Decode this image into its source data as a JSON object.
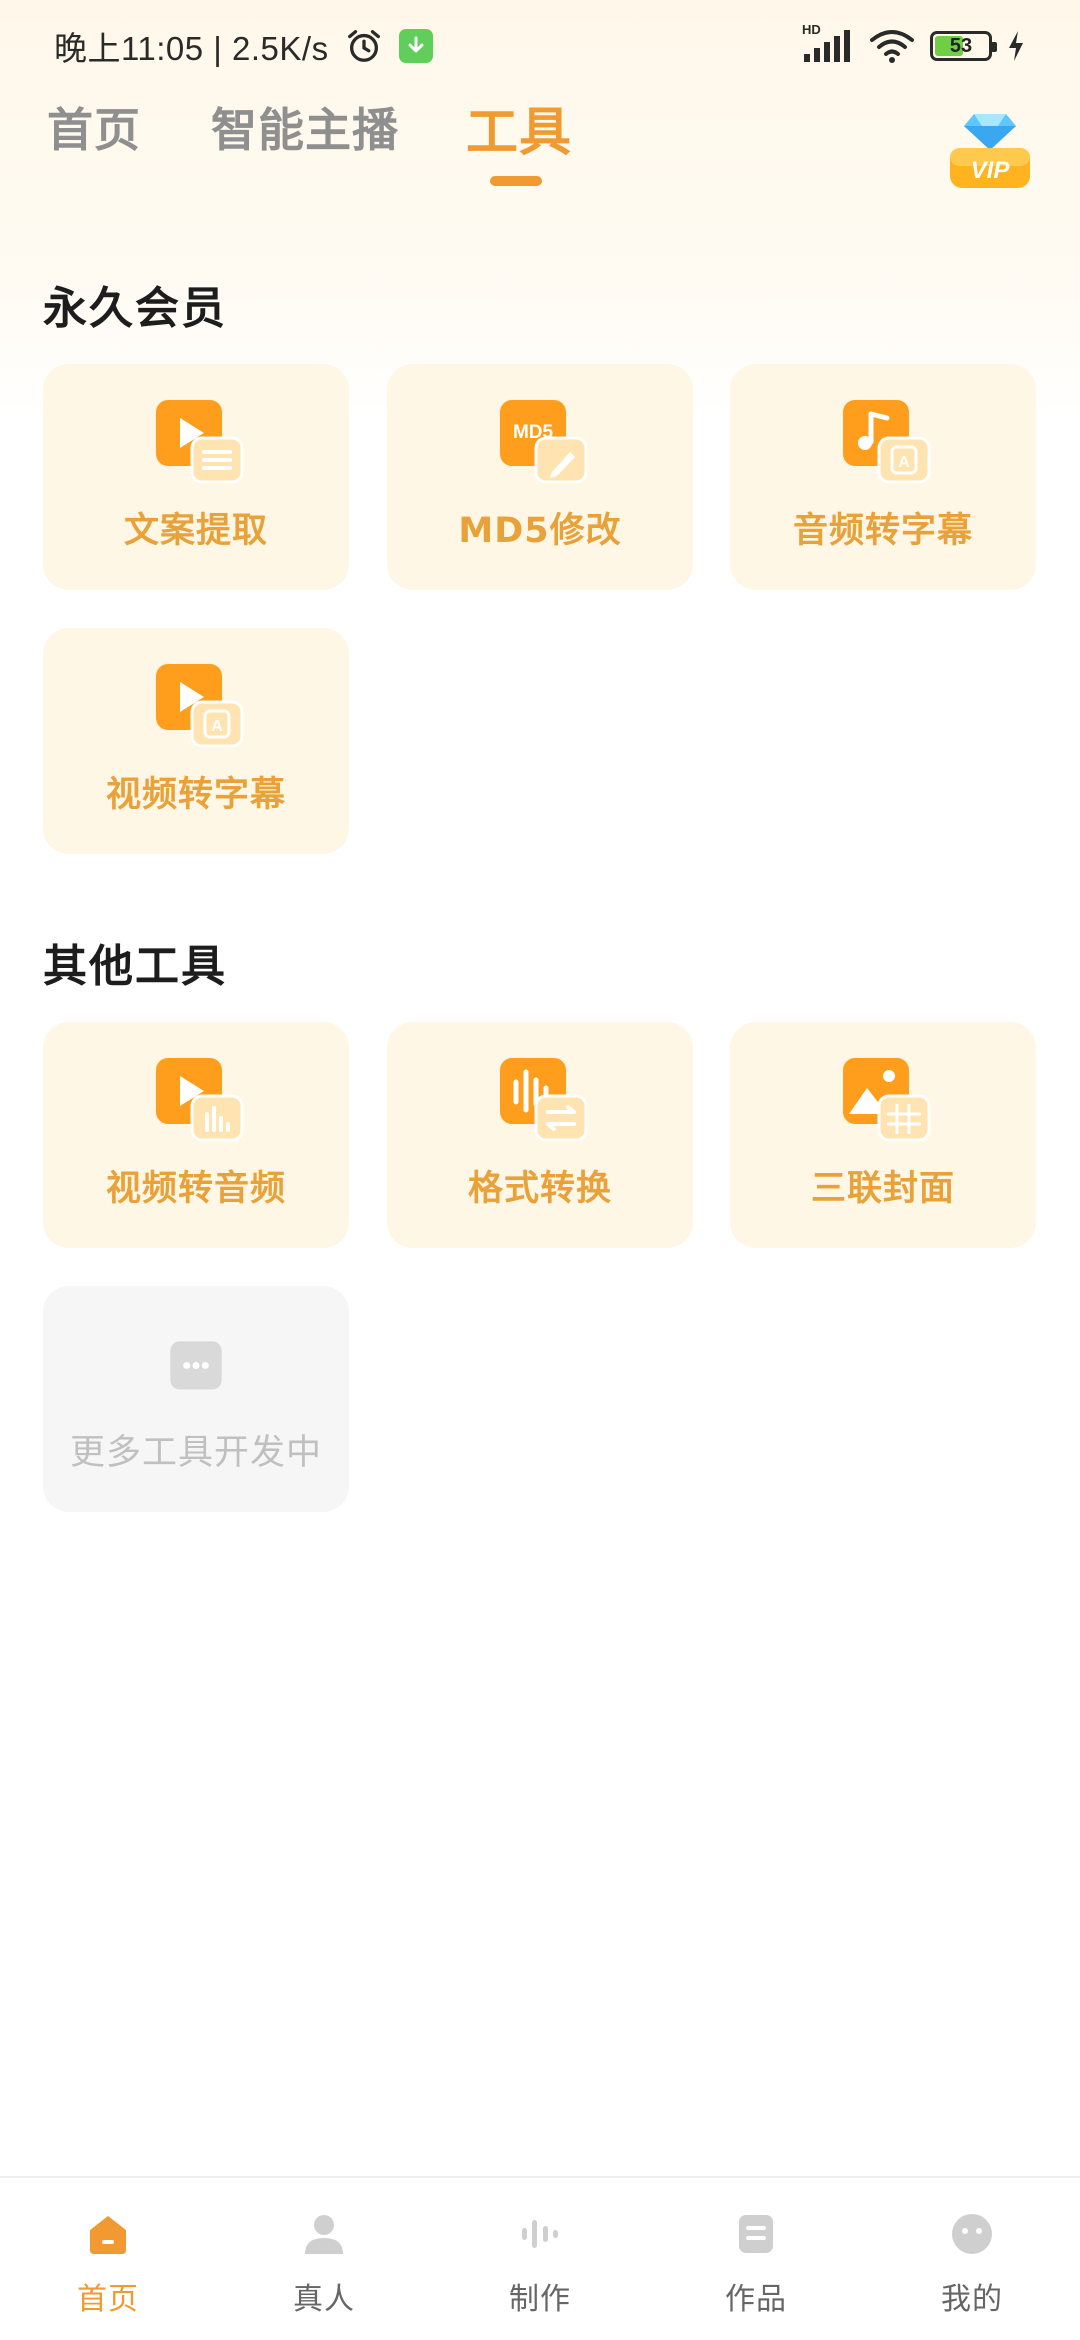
{
  "status_bar": {
    "time": "晚上11:05 | 2.5K/s",
    "network_badge": "HD",
    "battery_level": "53",
    "icons": [
      "alarm-icon",
      "download-icon",
      "signal-icon",
      "wifi-icon",
      "battery-icon",
      "charging-icon"
    ]
  },
  "header": {
    "tabs": [
      {
        "label": "首页",
        "active": false
      },
      {
        "label": "智能主播",
        "active": false
      },
      {
        "label": "工具",
        "active": true
      }
    ],
    "vip_label": "VIP"
  },
  "sections": [
    {
      "title": "永久会员",
      "items": [
        {
          "label": "文案提取",
          "icon": "play-text-icon",
          "badge": ""
        },
        {
          "label": "MD5修改",
          "icon": "md5-edit-icon",
          "badge": "MD5"
        },
        {
          "label": "音频转字幕",
          "icon": "music-subtitle-icon",
          "badge": "A"
        },
        {
          "label": "视频转字幕",
          "icon": "video-subtitle-icon",
          "badge": "A"
        }
      ]
    },
    {
      "title": "其他工具",
      "items": [
        {
          "label": "视频转音频",
          "icon": "video-audio-icon",
          "badge": ""
        },
        {
          "label": "格式转换",
          "icon": "format-convert-icon",
          "badge": ""
        },
        {
          "label": "三联封面",
          "icon": "triple-cover-icon",
          "badge": ""
        },
        {
          "label": "更多工具开发中",
          "icon": "more-icon",
          "badge": "",
          "disabled": true
        }
      ]
    }
  ],
  "bottom_nav": [
    {
      "label": "首页",
      "icon": "home-icon",
      "active": true
    },
    {
      "label": "真人",
      "icon": "person-icon",
      "active": false
    },
    {
      "label": "制作",
      "icon": "waveform-icon",
      "active": false
    },
    {
      "label": "作品",
      "icon": "works-icon",
      "active": false
    },
    {
      "label": "我的",
      "icon": "profile-face-icon",
      "active": false
    }
  ],
  "colors": {
    "accent": "#f19a32",
    "card_bg": "#fff7e5",
    "card_label": "#e9a13a",
    "icon_orange": "#ff9d1c",
    "icon_badge": "#ffe3b0",
    "disabled_bg": "#f6f6f6",
    "disabled_text": "#c0c0c0"
  }
}
